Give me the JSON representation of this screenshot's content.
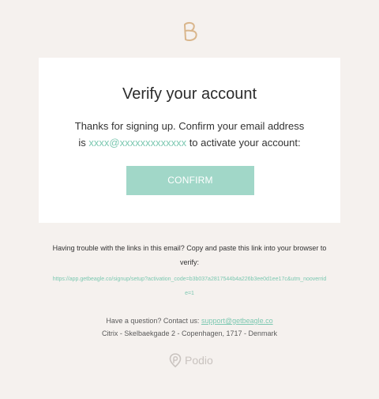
{
  "header": {
    "logo_icon": "beagle-b-logo-icon"
  },
  "card": {
    "title": "Verify your account",
    "line1": "Thanks for signing up. Confirm your email address",
    "line2_prefix": "is ",
    "email": "xxxx@xxxxxxxxxxxxx",
    "line2_suffix": " to activate your account:",
    "confirm_label": "CONFIRM"
  },
  "footer": {
    "trouble_text": "Having trouble with the links in this email? Copy and paste this link into your browser to verify:",
    "activation_url": "https://app.getbeagle.co/signup/setup?activation_code=b3b037a2817544b4a226b3ee0d1ee17c&utm_nooverride=1",
    "question_prefix": "Have a question? Contact us: ",
    "support_email": "support@getbeagle.co",
    "address": "Citrix - Skelbaekgade 2 - Copenhagen, 1717 - Denmark",
    "brand_icon": "podio-icon",
    "brand_name": "Podio"
  },
  "colors": {
    "background": "#f5f1ee",
    "accent": "#7cc8b1",
    "button": "#a1d7c8",
    "logo": "#d9b68c"
  }
}
